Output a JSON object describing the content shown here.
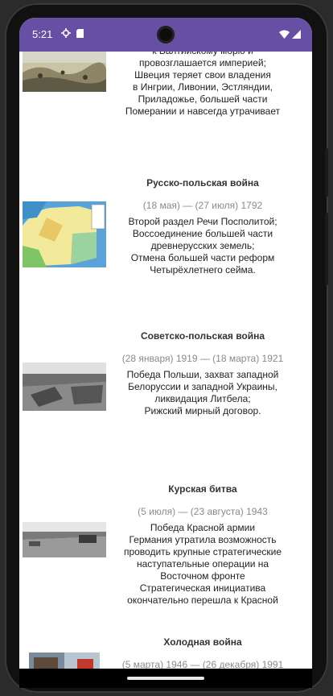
{
  "status": {
    "time": "5:21"
  },
  "entries": [
    {
      "title": "",
      "dates": "",
      "description": "к Балтийскому морю и\nпровозглашается империей;\nШвеция теряет свои владения\nв Ингрии, Ливонии, Эстляндии,\nПриладожье, большей части\nПомерании и навсегда утрачивает"
    },
    {
      "title": "Русско-польская война",
      "dates": "(18 мая) — (27 июля) 1792",
      "description": "Второй раздел Речи Посполитой;\nВоссоединение большей части\nдревнерусских земель;\nОтмена большей части реформ\nЧетырёхлетнего сейма."
    },
    {
      "title": "Советско-польская война",
      "dates": "(28 января) 1919 — (18 марта) 1921",
      "description": "Победа Польши, захват западной\nБелоруссии и западной Украины,\nликвидация Литбела;\nРижский мирный договор."
    },
    {
      "title": "Курская битва",
      "dates": "(5 июля) — (23 августа) 1943",
      "description": "Победа Красной армии\nГермания утратила возможность\nпроводить крупные стратегические\nнаступательные операции на\nВосточном фронте\nСтратегическая инициатива\nокончательно перешла к Красной"
    },
    {
      "title": "Холодная война",
      "dates": "(5 марта) 1946 — (26 декабря) 1991",
      "description": ""
    }
  ],
  "colors": {
    "statusbar": "#6750a4"
  }
}
